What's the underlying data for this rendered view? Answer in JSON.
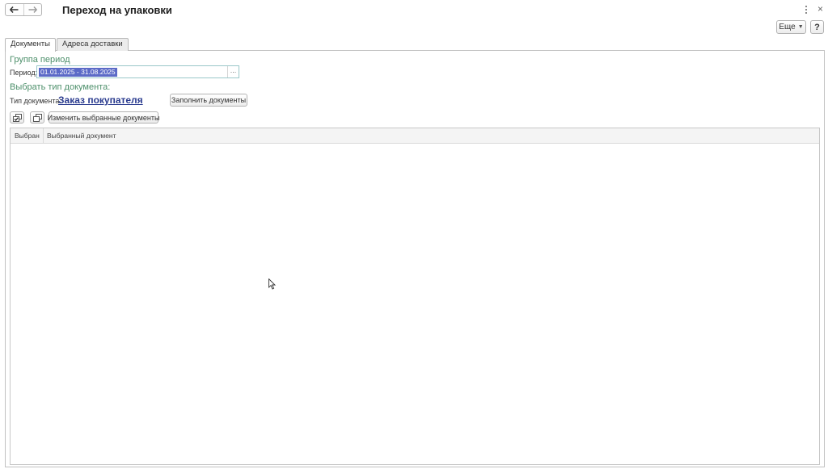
{
  "window": {
    "title": "Переход на упаковки",
    "more_label": "Еще",
    "help_label": "?",
    "close_label": "×"
  },
  "tabs": [
    {
      "label": "Документы",
      "active": true
    },
    {
      "label": "Адреса доставки",
      "active": false
    }
  ],
  "period_group": {
    "title": "Группа период",
    "label": "Период:",
    "value": "01.01.2025 - 31.08.2025",
    "picker_label": "..."
  },
  "doc_type_group": {
    "title": "Выбрать тип документа:",
    "label": "Тип документа:",
    "value": "Заказ покупателя",
    "fill_button": "Заполнить документы"
  },
  "toolbar": {
    "change_button": "Изменить выбранные документы"
  },
  "table": {
    "columns": [
      "Выбран",
      "Выбранный документ"
    ],
    "rows": []
  },
  "colors": {
    "group_title": "#4c8f6a",
    "link": "#2a3b8f",
    "selection": "#5b6ac7"
  }
}
